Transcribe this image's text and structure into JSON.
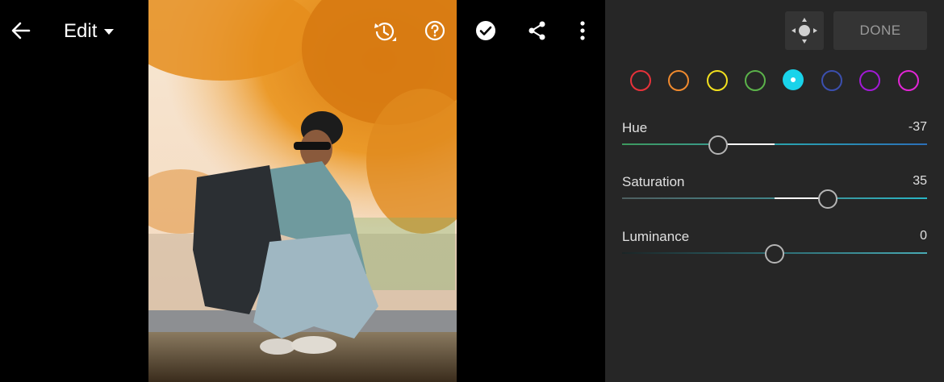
{
  "toolbar": {
    "back_icon": "arrow-left-icon",
    "edit_label": "Edit",
    "edit_caret_icon": "caret-down-icon",
    "history_icon": "history-icon",
    "help_icon": "help-circle-icon",
    "done_check_icon": "check-circle-icon",
    "share_icon": "share-icon",
    "more_icon": "more-vertical-icon"
  },
  "panel": {
    "targeted_adjust_icon": "targeted-adjustment-icon",
    "done_label": "DONE",
    "colors": [
      {
        "name": "red",
        "color": "#e8323a",
        "active": false
      },
      {
        "name": "orange",
        "color": "#f08a2e",
        "active": false
      },
      {
        "name": "yellow",
        "color": "#f2e01e",
        "active": false
      },
      {
        "name": "green",
        "color": "#5bb24a",
        "active": false
      },
      {
        "name": "aqua",
        "color": "#19d3ea",
        "active": true
      },
      {
        "name": "blue",
        "color": "#3b4fae",
        "active": false
      },
      {
        "name": "purple",
        "color": "#a21ad6",
        "active": false
      },
      {
        "name": "magenta",
        "color": "#e325d6",
        "active": false
      }
    ],
    "sliders": [
      {
        "label": "Hue",
        "value": "-37",
        "level": -37
      },
      {
        "label": "Saturation",
        "value": "35",
        "level": 35
      },
      {
        "label": "Luminance",
        "value": "0",
        "level": 0
      }
    ]
  }
}
